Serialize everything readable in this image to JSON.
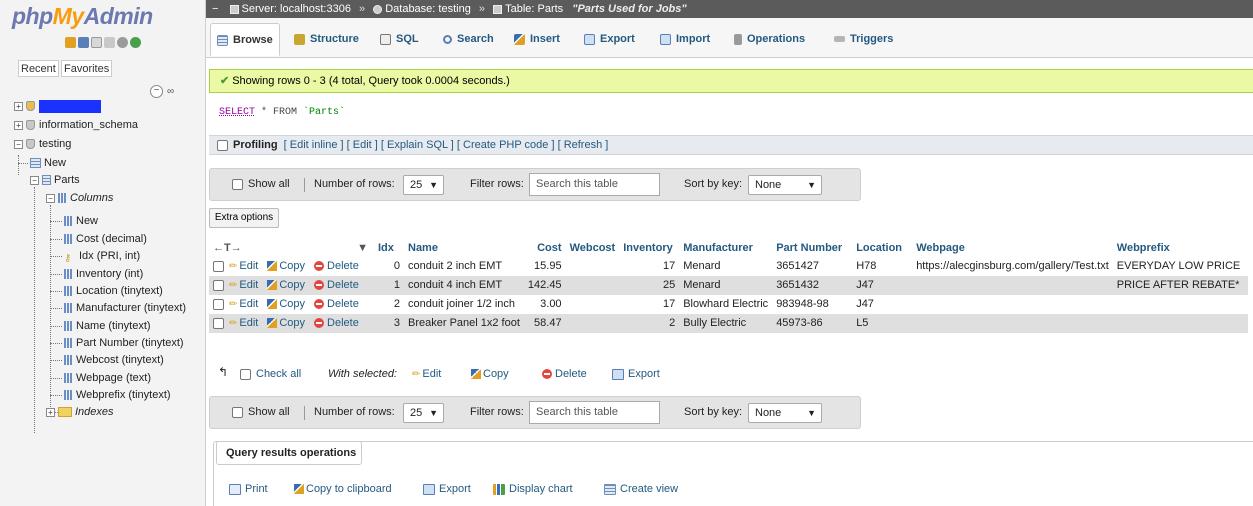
{
  "logo": {
    "php": "php",
    "my": "My",
    "admin": "Admin"
  },
  "sidebar": {
    "recent_tab": "Recent",
    "favorites_tab": "Favorites",
    "collapse_symbol": "−",
    "link_symbol": "∞",
    "databases": [
      "information_schema",
      "testing"
    ],
    "new_label": "New",
    "table_name": "Parts",
    "columns_label": "Columns",
    "columns": [
      "New",
      "Cost (decimal)",
      "Idx (PRI, int)",
      "Inventory (int)",
      "Location (tinytext)",
      "Manufacturer (tinytext)",
      "Name (tinytext)",
      "Part Number (tinytext)",
      "Webcost (tinytext)",
      "Webpage (text)",
      "Webprefix (tinytext)"
    ],
    "indexes_label": "Indexes"
  },
  "breadcrumb": {
    "server": "Server: localhost:3306",
    "database": "Database: testing",
    "table": "Table: Parts",
    "comment": "\"Parts Used for Jobs\"",
    "separator": "»"
  },
  "tabs": [
    "Browse",
    "Structure",
    "SQL",
    "Search",
    "Insert",
    "Export",
    "Import",
    "Operations",
    "Triggers"
  ],
  "success_message": "Showing rows 0 - 3 (4 total, Query took 0.0004 seconds.)",
  "sql": {
    "select": "SELECT",
    "rest": " * FROM ",
    "table": "`Parts`"
  },
  "profiling": {
    "label": "Profiling",
    "links": "[ Edit inline ] [ Edit ] [ Explain SQL ] [ Create PHP code ] [ Refresh ]"
  },
  "navigation": {
    "show_all": "Show all",
    "number_of_rows_label": "Number of rows:",
    "rows_value": "25",
    "filter_rows_label": "Filter rows:",
    "search_placeholder": "Search this table",
    "sort_by_key_label": "Sort by key:",
    "sort_value": "None"
  },
  "extra_options": "Extra options",
  "table": {
    "arrows": "←T→",
    "sort_arrow": "▼",
    "headers": [
      "Idx",
      "Name",
      "Cost",
      "Webcost",
      "Inventory",
      "Manufacturer",
      "Part Number",
      "Location",
      "Webpage",
      "Webprefix"
    ],
    "actions": {
      "edit": "Edit",
      "copy": "Copy",
      "delete": "Delete"
    },
    "rows": [
      {
        "idx": "0",
        "name": "conduit 2 inch EMT",
        "cost": "15.95",
        "webcost": "",
        "inventory": "17",
        "manufacturer": "Menard",
        "part_number": "3651427",
        "location": "H78",
        "webpage": "https://alecginsburg.com/gallery/Test.txt",
        "webprefix": "EVERYDAY LOW PRICE"
      },
      {
        "idx": "1",
        "name": "conduit 4 inch EMT",
        "cost": "142.45",
        "webcost": "",
        "inventory": "25",
        "manufacturer": "Menard",
        "part_number": "3651432",
        "location": "J47",
        "webpage": "",
        "webprefix": "PRICE AFTER REBATE*"
      },
      {
        "idx": "2",
        "name": "conduit joiner 1/2 inch",
        "cost": "3.00",
        "webcost": "",
        "inventory": "17",
        "manufacturer": "Blowhard Electric",
        "part_number": "983948-98",
        "location": "J47",
        "webpage": "",
        "webprefix": ""
      },
      {
        "idx": "3",
        "name": "Breaker Panel 1x2 foot",
        "cost": "58.47",
        "webcost": "",
        "inventory": "2",
        "manufacturer": "Bully Electric",
        "part_number": "45973-86",
        "location": "L5",
        "webpage": "",
        "webprefix": ""
      }
    ]
  },
  "bulk": {
    "check_all": "Check all",
    "with_selected": "With selected:",
    "edit": "Edit",
    "copy": "Copy",
    "delete": "Delete",
    "export": "Export"
  },
  "query_results_operations": {
    "title": "Query results operations",
    "items": [
      "Print",
      "Copy to clipboard",
      "Export",
      "Display chart",
      "Create view"
    ]
  }
}
